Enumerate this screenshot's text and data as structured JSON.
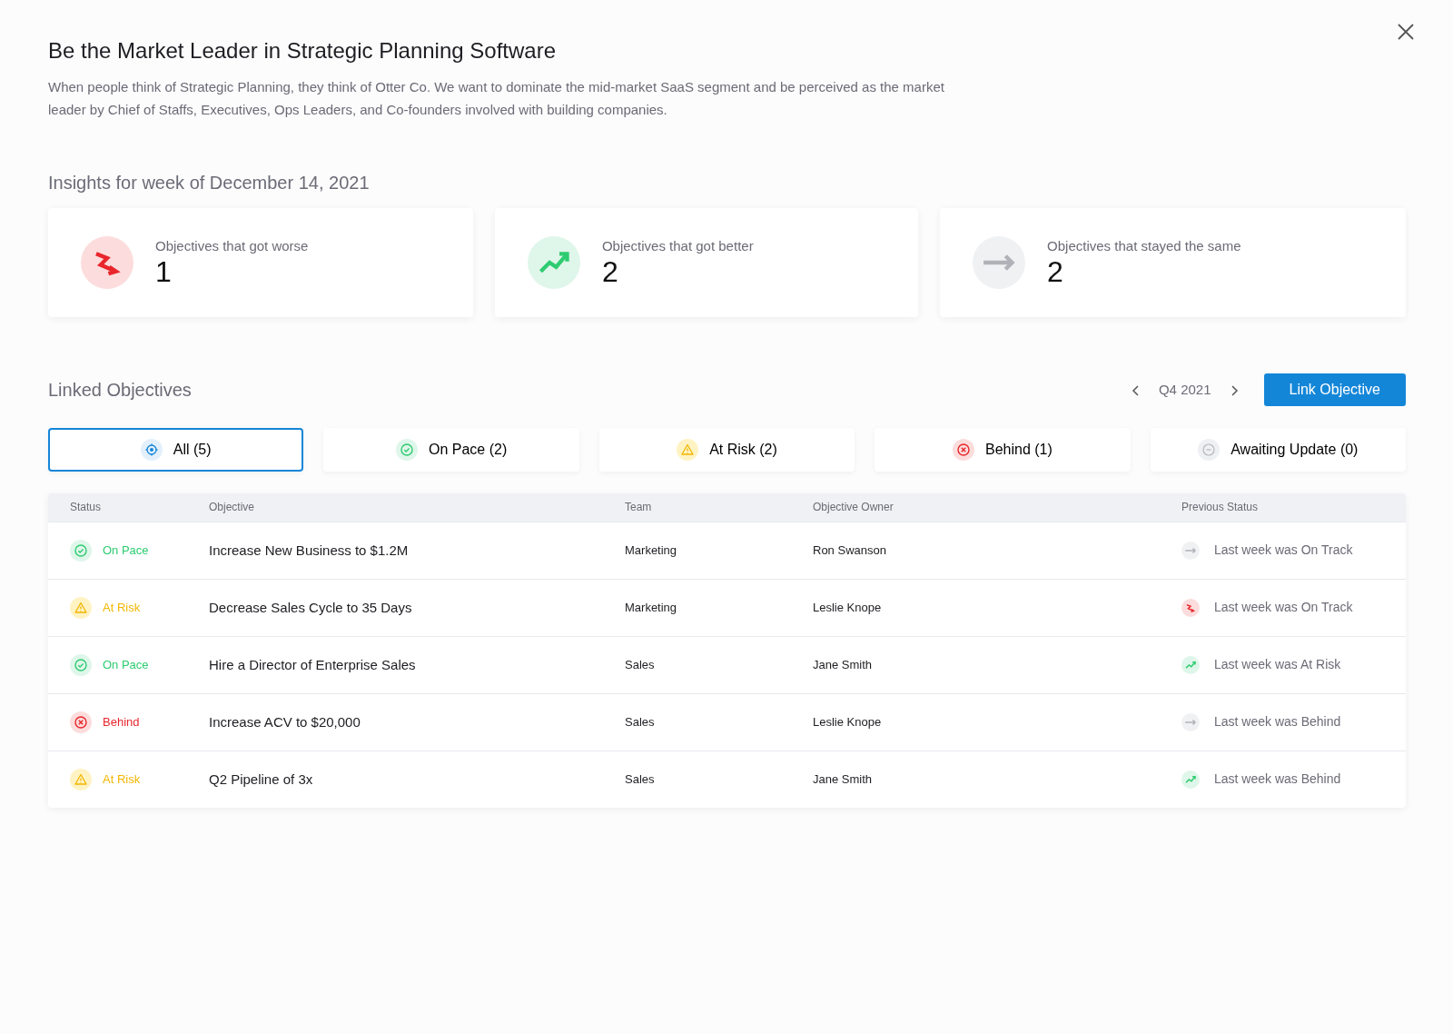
{
  "title": "Be the Market Leader in Strategic Planning Software",
  "description": "When people think of Strategic Planning, they think of Otter Co. We want to dominate the mid-market SaaS segment and be perceived as the market leader by Chief of Staffs, Executives, Ops Leaders, and Co-founders involved with building companies.",
  "insights": {
    "heading": "Insights for week of December 14, 2021",
    "cards": [
      {
        "kind": "worse",
        "label": "Objectives that got worse",
        "count": "1"
      },
      {
        "kind": "better",
        "label": "Objectives that got better",
        "count": "2"
      },
      {
        "kind": "same",
        "label": "Objectives that stayed the same",
        "count": "2"
      }
    ]
  },
  "linked": {
    "heading": "Linked Objectives",
    "period": "Q4 2021",
    "button": "Link Objective",
    "filters": [
      {
        "kind": "all",
        "label": "All",
        "count": "(5)",
        "selected": true
      },
      {
        "kind": "on_pace",
        "label": "On Pace",
        "count": "(2)",
        "selected": false
      },
      {
        "kind": "at_risk",
        "label": "At Risk",
        "count": "(2)",
        "selected": false
      },
      {
        "kind": "behind",
        "label": "Behind",
        "count": "(1)",
        "selected": false
      },
      {
        "kind": "awaiting",
        "label": "Awaiting Update",
        "count": "(0)",
        "selected": false
      }
    ],
    "table": {
      "columns": [
        "Status",
        "Objective",
        "Team",
        "Objective Owner",
        "Previous Status"
      ],
      "rows": [
        {
          "status": {
            "kind": "on_pace",
            "label": "On Pace"
          },
          "objective": "Increase New Business to $1.2M",
          "team": "Marketing",
          "owner": "Ron Swanson",
          "previous": {
            "kind": "same",
            "label": "Last week was On Track"
          }
        },
        {
          "status": {
            "kind": "at_risk",
            "label": "At Risk"
          },
          "objective": "Decrease Sales Cycle to 35 Days",
          "team": "Marketing",
          "owner": "Leslie Knope",
          "previous": {
            "kind": "worse",
            "label": "Last week was On Track"
          }
        },
        {
          "status": {
            "kind": "on_pace",
            "label": "On Pace"
          },
          "objective": "Hire a Director of Enterprise Sales",
          "team": "Sales",
          "owner": "Jane Smith",
          "previous": {
            "kind": "better",
            "label": "Last week was At Risk"
          }
        },
        {
          "status": {
            "kind": "behind",
            "label": "Behind"
          },
          "objective": "Increase ACV to $20,000",
          "team": "Sales",
          "owner": "Leslie Knope",
          "previous": {
            "kind": "same",
            "label": "Last week was Behind"
          }
        },
        {
          "status": {
            "kind": "at_risk",
            "label": "At Risk"
          },
          "objective": "Q2 Pipeline of 3x",
          "team": "Sales",
          "owner": "Jane Smith",
          "previous": {
            "kind": "better",
            "label": "Last week was Behind"
          }
        }
      ]
    }
  }
}
